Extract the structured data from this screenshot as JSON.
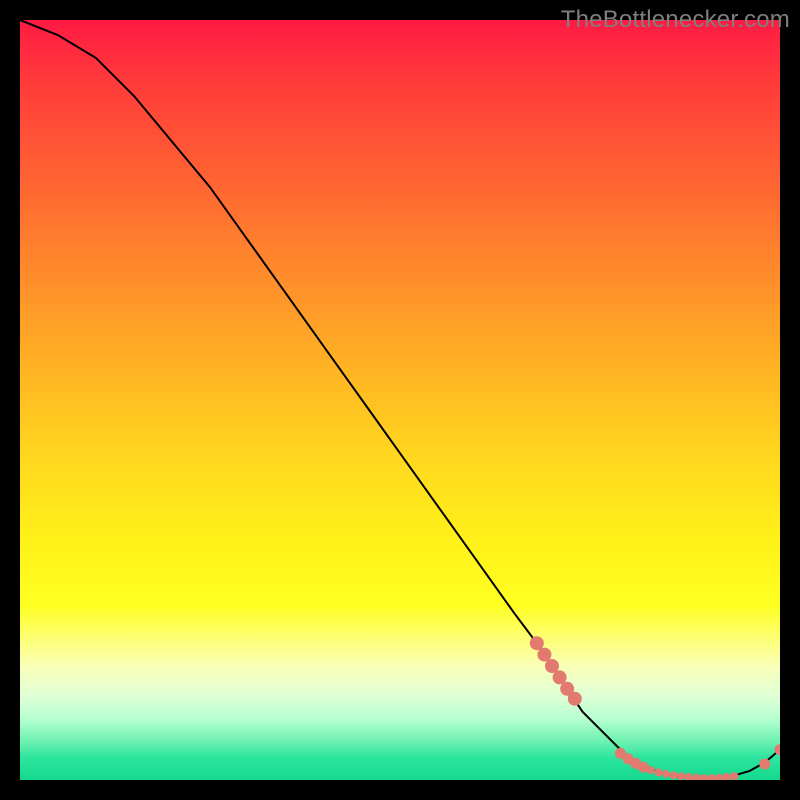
{
  "watermark": "TheBottlenecker.com",
  "colors": {
    "marker": "#e37a6f",
    "line": "#000000",
    "frame": "#000000"
  },
  "chart_data": {
    "type": "line",
    "title": "",
    "xlabel": "",
    "ylabel": "",
    "xlim": [
      0,
      100
    ],
    "ylim": [
      0,
      100
    ],
    "x": [
      0,
      5,
      10,
      15,
      20,
      25,
      30,
      35,
      40,
      45,
      50,
      55,
      60,
      65,
      68,
      70,
      72,
      74,
      76,
      78,
      80,
      82,
      84,
      86,
      88,
      90,
      92,
      94,
      96,
      98,
      100
    ],
    "y": [
      100,
      98,
      95,
      90,
      84,
      78,
      71,
      64,
      57,
      50,
      43,
      36,
      29,
      22,
      18,
      15,
      12,
      9,
      7,
      5,
      3,
      2,
      1,
      0.5,
      0.3,
      0.2,
      0.3,
      0.6,
      1.2,
      2.3,
      4
    ],
    "markers_x": [
      68,
      69,
      70,
      71,
      72,
      73,
      79,
      80,
      81,
      82,
      83,
      84,
      85,
      86,
      87,
      88,
      89,
      90,
      91,
      92,
      93,
      94,
      98,
      100
    ],
    "markers_y": [
      18,
      16.5,
      15,
      13.5,
      12,
      10.7,
      3.5,
      2.8,
      2.2,
      1.7,
      1.3,
      1,
      0.8,
      0.6,
      0.5,
      0.4,
      0.3,
      0.25,
      0.25,
      0.3,
      0.4,
      0.5,
      2.1,
      4
    ],
    "annotations": [
      {
        "x": 85,
        "y": 1.2
      }
    ]
  }
}
